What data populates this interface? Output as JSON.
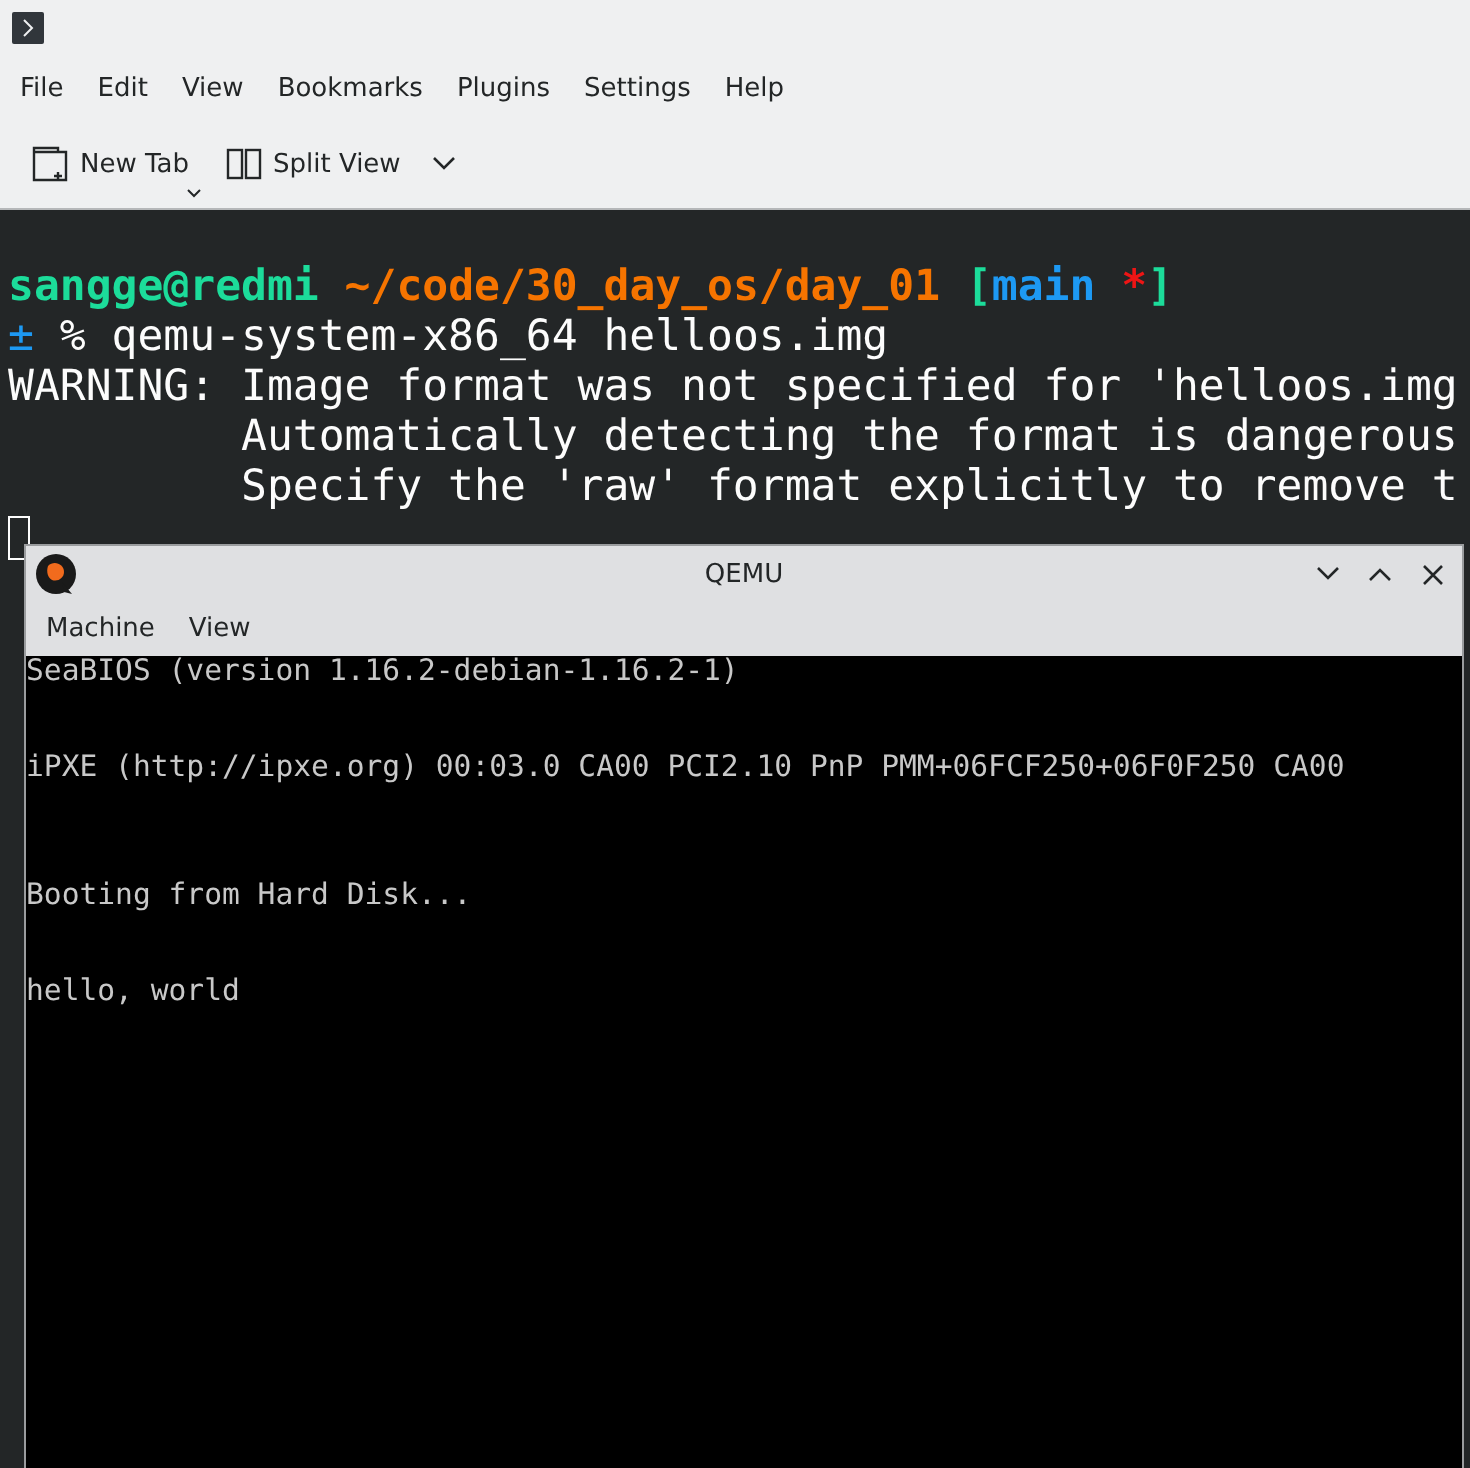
{
  "menu_bar": [
    "File",
    "Edit",
    "View",
    "Bookmarks",
    "Plugins",
    "Settings",
    "Help"
  ],
  "toolbar": [
    {
      "label": "New Tab",
      "kind": "new-tab"
    },
    {
      "label": "Split View",
      "kind": "split-view"
    }
  ],
  "terminal": {
    "prompt": [
      {
        "text": "sangge",
        "color": "#1cdc9a"
      },
      {
        "text": "@",
        "color": "#1cdc9a"
      },
      {
        "text": "redmi",
        "color": "#1cdc9a"
      },
      {
        "text": " ~/code/30_day_os/day_01 ",
        "color": "#f67400"
      },
      {
        "text": "[",
        "color": "#1cdc9a"
      },
      {
        "text": "main",
        "color": "#1d99f3"
      },
      {
        "text": " *",
        "color": "#ed1515"
      },
      {
        "text": "]",
        "color": "#1cdc9a"
      }
    ],
    "command_marker": "±",
    "command": " % qemu-system-x86_64 helloos.img",
    "output": [
      "WARNING: Image format was not specified for 'helloos.img",
      "         Automatically detecting the format is dangerous",
      "         Specify the 'raw' format explicitly to remove t"
    ]
  },
  "qemu_window": {
    "title": "QEMU",
    "menu": [
      "Machine",
      "View"
    ],
    "screen_lines": [
      "SeaBIOS (version 1.16.2-debian-1.16.2-1)",
      "iPXE (http://ipxe.org) 00:03.0 CA00 PCI2.10 PnP PMM+06FCF250+06F0F250 CA00",
      "Booting from Hard Disk...",
      "hello, world"
    ]
  }
}
